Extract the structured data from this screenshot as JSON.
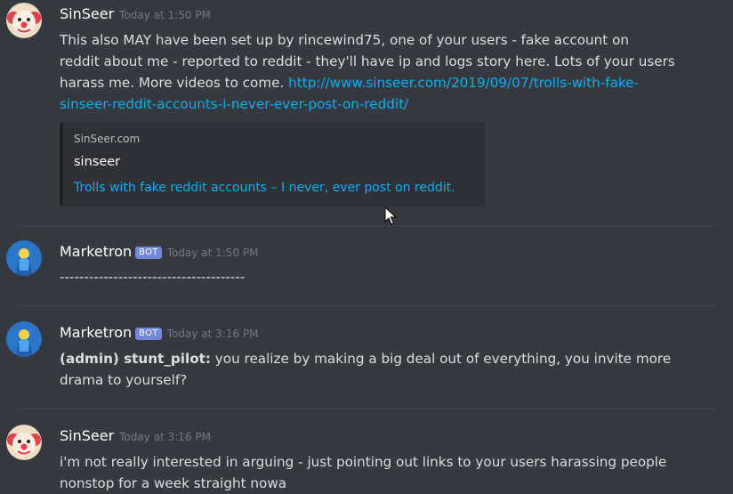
{
  "messages": [
    {
      "author": "SinSeer",
      "avatar": "clown-avatar",
      "timestamp": "Today at 1:50 PM",
      "lines": [
        "This also MAY have been set up by rincewind75, one of your users - fake account on",
        "reddit about me - reported to reddit - they'll have ip and logs story here. Lots of your users",
        "harass me. More videos to come. "
      ],
      "link_part1": "http://www.sinseer.com/2019/09/07/trolls-with-fake-",
      "link_part2": "sinseer-reddit-accounts-i-never-ever-post-on-reddit/",
      "embed": {
        "provider": "SinSeer.com",
        "title": "sinseer",
        "description": "Trolls with fake reddit accounts – I never, ever post on reddit."
      }
    },
    {
      "author": "Marketron",
      "badge": "BOT",
      "avatar": "blue-figure-avatar",
      "timestamp": "Today at 1:50 PM",
      "text": "--------------------------------------"
    },
    {
      "author": "Marketron",
      "badge": "BOT",
      "avatar": "blue-figure-avatar",
      "timestamp": "Today at 3:16 PM",
      "bold_prefix": "(admin) stunt_pilot:",
      "text_line1": " you realize by making a big deal out of everything, you invite more",
      "text_line2": "drama to yourself?"
    },
    {
      "author": "SinSeer",
      "avatar": "clown-avatar",
      "timestamp": "Today at 3:16 PM",
      "line1": "i'm not really interested in arguing - just pointing out links to your users harassing people",
      "line2": "nonstop for a week straight nowa"
    }
  ],
  "colors": {
    "background": "#36393f",
    "link": "#00b0f4",
    "bot_badge": "#7289da",
    "timestamp": "#72767d",
    "embed_bg": "#2f3136"
  }
}
